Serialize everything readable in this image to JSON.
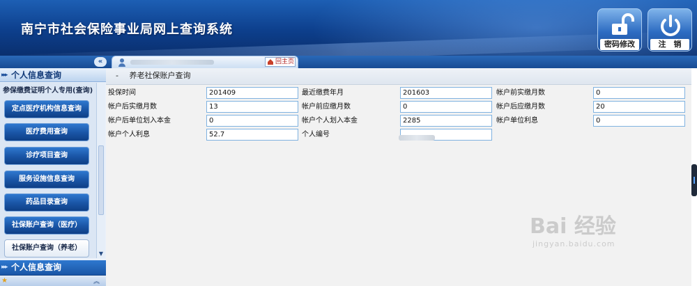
{
  "header": {
    "title": "南宁市社会保险事业局网上查询系统",
    "buttons": [
      {
        "label": "密码修改",
        "icon": "unlock-icon"
      },
      {
        "label": "注　销",
        "icon": "power-icon"
      }
    ]
  },
  "tabbar": {
    "collapse_label": "«",
    "home_label": "回主页"
  },
  "sidebar": {
    "section1_title": "个人信息查询",
    "truncated_item": "参保缴费证明个人专用(查询)",
    "items": [
      {
        "label": "定点医疗机构信息查询"
      },
      {
        "label": "医疗费用查询"
      },
      {
        "label": "诊疗项目查询"
      },
      {
        "label": "服务设施信息查询"
      },
      {
        "label": "药品目录查询"
      },
      {
        "label": "社保账户查询（医疗）"
      },
      {
        "label": "社保账户查询（养老）"
      }
    ],
    "active_index": 6,
    "section2_title": "个人信息查询"
  },
  "content": {
    "section_dash": "-",
    "section_title": "养老社保账户查询",
    "fields": [
      {
        "label": "投保时间",
        "value": "201409"
      },
      {
        "label": "最近缴费年月",
        "value": "201603"
      },
      {
        "label": "帐户前实缴月数",
        "value": "0"
      },
      {
        "label": "帐户后实缴月数",
        "value": "13"
      },
      {
        "label": "帐户前应缴月数",
        "value": "0"
      },
      {
        "label": "帐户后应缴月数",
        "value": "20"
      },
      {
        "label": "帐户后单位划入本金",
        "value": "0"
      },
      {
        "label": "帐户个人划入本金",
        "value": "2285"
      },
      {
        "label": "帐户单位利息",
        "value": "0"
      },
      {
        "label": "帐户个人利息",
        "value": "52.7"
      },
      {
        "label": "个人编号",
        "value": ""
      }
    ]
  },
  "watermark": {
    "brand": "Bai 经验",
    "url": "jingyan.baidu.com"
  },
  "colors": {
    "header_blue": "#0d3f8c",
    "sidebar_button": "#1b57a8",
    "input_border": "#7fb2e0"
  }
}
